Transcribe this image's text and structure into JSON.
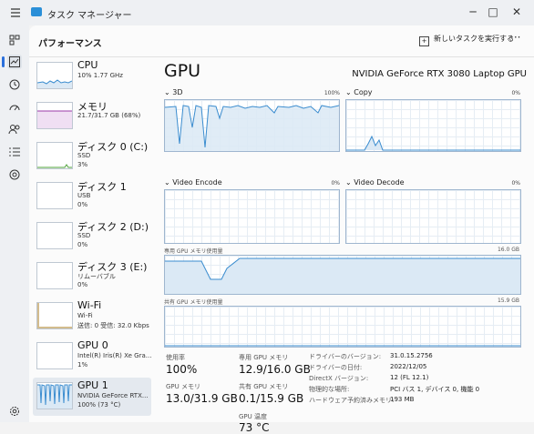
{
  "window": {
    "title": "タスク マネージャー",
    "minimize": "─",
    "maximize": "□",
    "close": "✕"
  },
  "nav": {
    "icons": [
      "menu-icon",
      "processes-icon",
      "performance-icon",
      "app-history-icon",
      "startup-icon",
      "users-icon",
      "details-icon",
      "services-icon",
      "settings-icon"
    ],
    "active": "performance-icon"
  },
  "header": {
    "page_title": "パフォーマンス",
    "run_task_label": "新しいタスクを実行する",
    "more_label": "···"
  },
  "sidebar": {
    "cpu": {
      "name": "CPU",
      "line1": "10% 1.77 GHz",
      "line2": ""
    },
    "memory": {
      "name": "メモリ",
      "line1": "21.7/31.7 GB (68%)",
      "line2": ""
    },
    "disk0": {
      "name": "ディスク 0 (C:)",
      "line1": "SSD",
      "line2": "3%"
    },
    "disk1": {
      "name": "ディスク 1",
      "line1": "USB",
      "line2": "0%"
    },
    "disk2": {
      "name": "ディスク 2 (D:)",
      "line1": "SSD",
      "line2": "0%"
    },
    "disk3": {
      "name": "ディスク 3 (E:)",
      "line1": "リムーバブル",
      "line2": "0%"
    },
    "wifi": {
      "name": "Wi-Fi",
      "line1": "Wi-Fi",
      "line2": "送信: 0 受信: 32.0 Kbps"
    },
    "gpu0": {
      "name": "GPU 0",
      "line1": "Intel(R) Iris(R) Xe Gra...",
      "line2": "1%"
    },
    "gpu1": {
      "name": "GPU 1",
      "line1": "NVIDIA GeForce RTX...",
      "line2": "100% (73 °C)"
    }
  },
  "content": {
    "title": "GPU",
    "model": "NVIDIA GeForce RTX 3080 Laptop GPU",
    "graphs": {
      "g3d": {
        "label": "3D",
        "pct": "100%"
      },
      "copy": {
        "label": "Copy",
        "pct": "0%"
      },
      "encode": {
        "label": "Video Encode",
        "pct": "0%"
      },
      "encode_max": "0%",
      "decode": {
        "label": "Video Decode",
        "pct": "0%"
      },
      "decode_max": "0%",
      "dedicated": {
        "label": "専用 GPU メモリ使用量",
        "max": "16.0 GB"
      },
      "shared": {
        "label": "共有 GPU メモリ使用量",
        "max": "15.9 GB"
      }
    },
    "stats": {
      "usage_label": "使用率",
      "usage_value": "100%",
      "ded_label": "専用 GPU メモリ",
      "ded_value": "12.9/16.0 GB",
      "gpumem_label": "GPU メモリ",
      "gpumem_value": "13.0/31.9 GB",
      "shared_label": "共有 GPU メモリ",
      "shared_value": "0.1/15.9 GB",
      "temp_label": "GPU 温度",
      "temp_value": "73 °C"
    },
    "info": [
      {
        "key": "ドライバーのバージョン:",
        "value": "31.0.15.2756"
      },
      {
        "key": "ドライバーの日付:",
        "value": "2022/12/05"
      },
      {
        "key": "DirectX バージョン:",
        "value": "12 (FL 12.1)"
      },
      {
        "key": "物理的な場所:",
        "value": "PCI バス 1, デバイス 0, 機能 0"
      },
      {
        "key": "ハードウェア予約済みメモリ:",
        "value": "193 MB"
      }
    ]
  },
  "colors": {
    "gpu": "#3a8ccf",
    "gpu_fill": "#dbe9f5",
    "cpu": "#3a8ccf",
    "memory": "#9b3ba8",
    "disk": "#4fa33b",
    "wifi": "#a7781b"
  }
}
